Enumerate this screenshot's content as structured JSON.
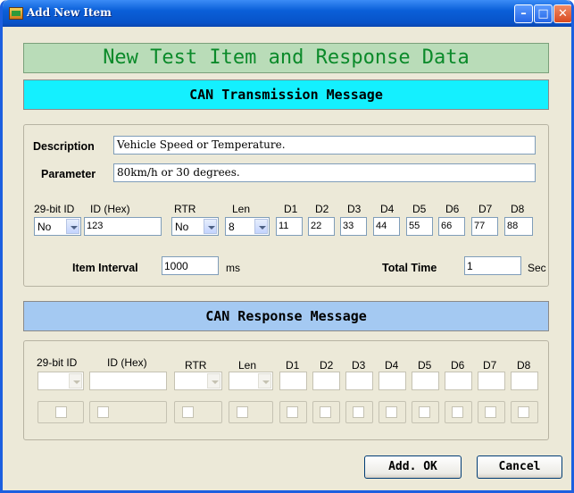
{
  "window": {
    "title": "Add New Item"
  },
  "banner": "New Test Item and Response Data",
  "tx": {
    "header": "CAN Transmission Message",
    "description_label": "Description",
    "description_value": "Vehicle Speed or Temperature.",
    "parameter_label": "Parameter",
    "parameter_value": "80km/h or 30 degrees.",
    "cols": {
      "ext": "29-bit ID",
      "id": "ID (Hex)",
      "rtr": "RTR",
      "len": "Len",
      "d1": "D1",
      "d2": "D2",
      "d3": "D3",
      "d4": "D4",
      "d5": "D5",
      "d6": "D6",
      "d7": "D7",
      "d8": "D8"
    },
    "values": {
      "ext": "No",
      "id": "123",
      "rtr": "No",
      "len": "8",
      "d1": "11",
      "d2": "22",
      "d3": "33",
      "d4": "44",
      "d5": "55",
      "d6": "66",
      "d7": "77",
      "d8": "88"
    },
    "interval_label": "Item Interval",
    "interval_value": "1000",
    "interval_unit": "ms",
    "total_label": "Total Time",
    "total_value": "1",
    "total_unit": "Sec"
  },
  "rx": {
    "header": "CAN Response Message",
    "cols": {
      "ext": "29-bit ID",
      "id": "ID (Hex)",
      "rtr": "RTR",
      "len": "Len",
      "d1": "D1",
      "d2": "D2",
      "d3": "D3",
      "d4": "D4",
      "d5": "D5",
      "d6": "D6",
      "d7": "D7",
      "d8": "D8"
    }
  },
  "buttons": {
    "ok": "Add. OK",
    "cancel": "Cancel"
  },
  "colors": {
    "title_bar": "#0a5fd8",
    "banner_bg": "#b9dcb8",
    "banner_text": "#0b8a2a",
    "tx_header": "#14f0ff",
    "rx_header": "#a4c9f2"
  }
}
